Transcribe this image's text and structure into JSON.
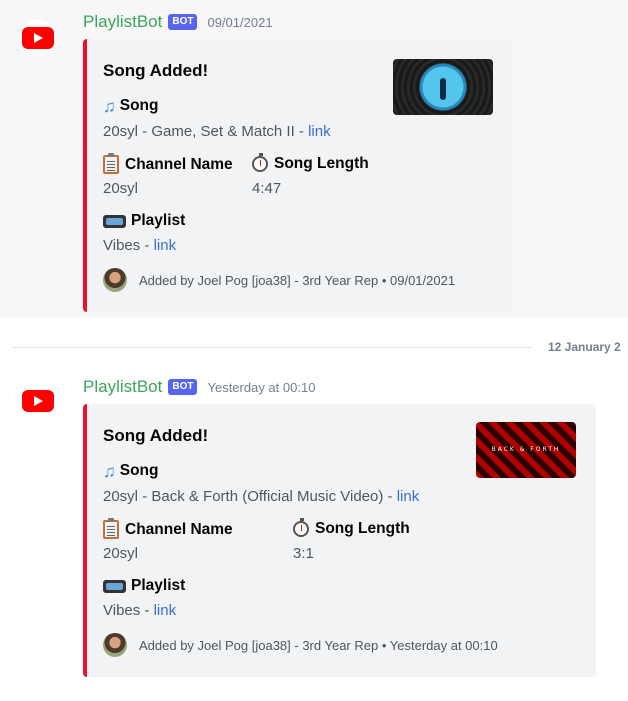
{
  "messages": [
    {
      "username": "PlaylistBot",
      "bot_tag": "BOT",
      "timestamp": "09/01/2021",
      "embed": {
        "title": "Song Added!",
        "song_label": "Song",
        "song_value": "20syl - Game, Set & Match II - ",
        "song_link": "link",
        "channel_label": "Channel Name",
        "channel_value": "20syl",
        "length_label": "Song Length",
        "length_value": "4:47",
        "playlist_label": "Playlist",
        "playlist_value": "Vibes - ",
        "playlist_link": "link",
        "footer": "Added by Joel Pog [joa38] - 3rd Year Rep • 09/01/2021"
      }
    },
    {
      "username": "PlaylistBot",
      "bot_tag": "BOT",
      "timestamp": "Yesterday at 00:10",
      "embed": {
        "title": "Song Added!",
        "song_label": "Song",
        "song_value": "20syl - Back & Forth (Official Music Video) - ",
        "song_link": "link",
        "channel_label": "Channel Name",
        "channel_value": "20syl",
        "length_label": "Song Length",
        "length_value": "3:1",
        "playlist_label": "Playlist",
        "playlist_value": "Vibes - ",
        "playlist_link": "link",
        "footer": "Added by Joel Pog [joa38] - 3rd Year Rep • Yesterday at 00:10",
        "thumbnail_text": "BACK & FORTH"
      }
    }
  ],
  "divider": {
    "date": "12 January 2"
  },
  "colors": {
    "accent": "#e8102a",
    "username": "#3ba55c",
    "bot_tag": "#5865f2",
    "link": "#3b6fd3"
  },
  "icons": [
    "youtube-icon",
    "musical-notes-icon",
    "clipboard-icon",
    "stopwatch-icon",
    "videocassette-icon"
  ]
}
